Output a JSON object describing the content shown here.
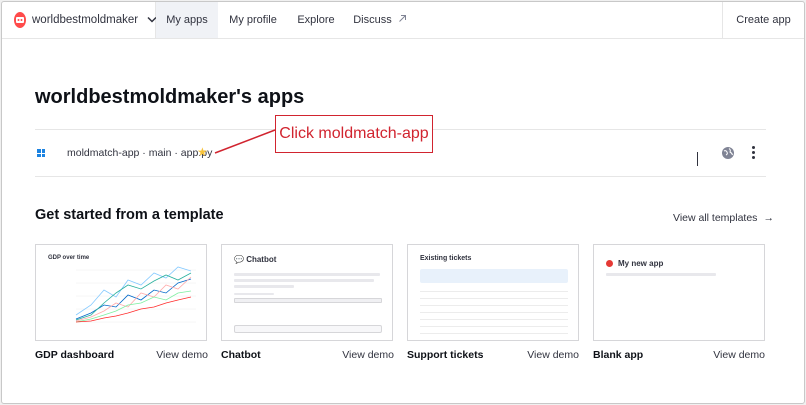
{
  "nav": {
    "workspace": "worldbestmoldmaker",
    "items": [
      "My apps",
      "My profile",
      "Explore",
      "Discuss"
    ],
    "create": "Create app"
  },
  "page": {
    "title": "worldbestmoldmaker's apps"
  },
  "app": {
    "name": "moldmatch-app · main · app.py"
  },
  "annotation": {
    "text": "Click moldmatch-app"
  },
  "templates": {
    "heading": "Get started from a template",
    "view_all": "View all templates",
    "cards": [
      {
        "label": "GDP dashboard",
        "demo": "View demo",
        "thumb_title": "GDP over time"
      },
      {
        "label": "Chatbot",
        "demo": "View demo",
        "thumb_title": "Chatbot"
      },
      {
        "label": "Support tickets",
        "demo": "View demo",
        "thumb_title": "Existing tickets"
      },
      {
        "label": "Blank app",
        "demo": "View demo",
        "thumb_title": "My new app"
      }
    ]
  },
  "colors": {
    "accent": "#ff4b4b",
    "annotation": "#d1242f",
    "link_blue": "#1c83e1",
    "star": "#f7c33b"
  },
  "icons": [
    "workspace-avatar-icon",
    "chevron-down-icon",
    "external-link-icon",
    "app-grid-icon",
    "star-icon",
    "globe-icon",
    "more-vertical-icon",
    "arrow-right-icon"
  ]
}
